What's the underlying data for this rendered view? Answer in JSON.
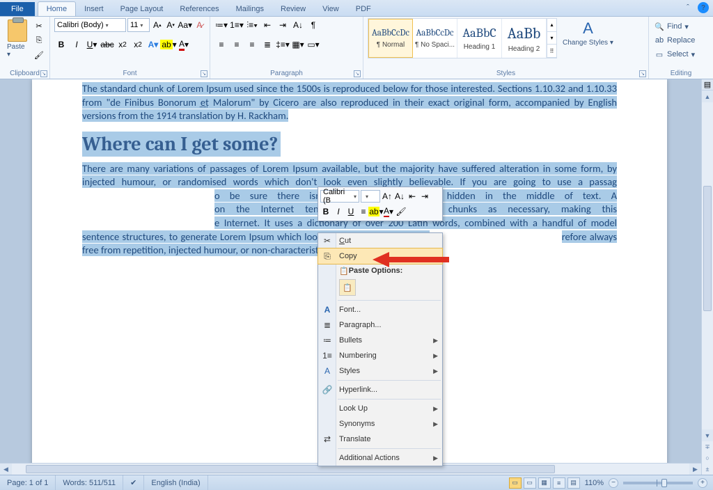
{
  "tabs": {
    "file": "File",
    "home": "Home",
    "insert": "Insert",
    "pageLayout": "Page Layout",
    "references": "References",
    "mailings": "Mailings",
    "review": "Review",
    "view": "View",
    "pdf": "PDF"
  },
  "ribbon": {
    "clipboard": {
      "label": "Clipboard",
      "paste": "Paste"
    },
    "font": {
      "label": "Font",
      "family": "Calibri (Body)",
      "size": "11"
    },
    "paragraph": {
      "label": "Paragraph"
    },
    "styles": {
      "label": "Styles",
      "items": [
        {
          "preview": "AaBbCcDc",
          "name": "¶ Normal",
          "selected": true,
          "cls": "p1"
        },
        {
          "preview": "AaBbCcDc",
          "name": "¶ No Spaci...",
          "selected": false,
          "cls": "p1"
        },
        {
          "preview": "AaBbC",
          "name": "Heading 1",
          "selected": false,
          "cls": "p2"
        },
        {
          "preview": "AaBb",
          "name": "Heading 2",
          "selected": false,
          "cls": "p3"
        }
      ],
      "change": "Change Styles"
    },
    "editing": {
      "label": "Editing",
      "find": "Find",
      "replace": "Replace",
      "select": "Select"
    }
  },
  "document": {
    "para1": "The standard chunk of Lorem Ipsum used since the 1500s is reproduced below for those interested. Sections 1.10.32 and 1.10.33 from \"de Finibus Bonorum ",
    "para1_et": "et",
    "para1b": " Malorum\" by Cicero are also reproduced in their exact original form, accompanied by English versions from the 1914 translation by H. Rackham.",
    "heading": "Where can I get some?",
    "para2a": "There are many variations of passages of Lorem Ipsum available, but the majority have suffered alteration in some form, by injected humour, or randomised words which don't look even slightly believable. If you are going to use a passag",
    "para2gap1": "o be sure there isn't anything embarrassing hidden in the middle of text. A",
    "para2gap2": "on the Internet tend to repeat predefined chunks as necessary, making this",
    "para2gap3": "e Internet. It uses a dictionary of over 200 Latin words, combined with a handful of model sentence structures, to generate Lorem Ipsum which looks reasonable. The generat",
    "para2gap4": "refore always free from repetition, injected humour, or non-characteristic words"
  },
  "minitoolbar": {
    "font": "Calibri (B",
    "size": ""
  },
  "context": {
    "cut": "Cut",
    "copy": "Copy",
    "pasteHeader": "Paste Options:",
    "font": "Font...",
    "paragraph": "Paragraph...",
    "bullets": "Bullets",
    "numbering": "Numbering",
    "styles": "Styles",
    "hyperlink": "Hyperlink...",
    "lookup": "Look Up",
    "synonyms": "Synonyms",
    "translate": "Translate",
    "additional": "Additional Actions"
  },
  "status": {
    "page": "Page: 1 of 1",
    "words": "Words: 511/511",
    "lang": "English (India)",
    "zoom": "110%"
  }
}
